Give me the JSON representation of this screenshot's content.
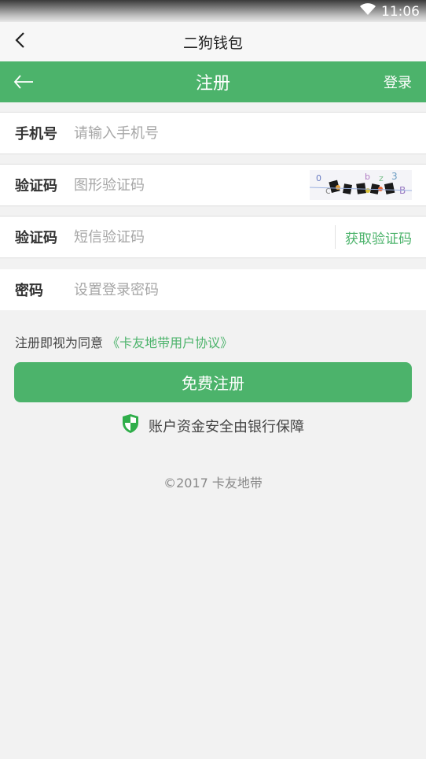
{
  "status_bar": {
    "time": "11:06",
    "wifi_icon": "wifi-icon"
  },
  "title_bar": {
    "title": "二狗钱包",
    "back_icon": "chevron-left-icon"
  },
  "header": {
    "title": "注册",
    "login_label": "登录",
    "back_icon": "arrow-left-icon"
  },
  "form": {
    "phone": {
      "label": "手机号",
      "placeholder": "请输入手机号",
      "value": ""
    },
    "captcha": {
      "label": "验证码",
      "placeholder": "图形验证码",
      "value": ""
    },
    "sms": {
      "label": "验证码",
      "placeholder": "短信验证码",
      "value": "",
      "button_label": "获取验证码"
    },
    "password": {
      "label": "密码",
      "placeholder": "设置登录密码",
      "value": ""
    }
  },
  "agreement": {
    "prefix": "注册即视为同意",
    "link_text": "《卡友地带用户协议》"
  },
  "submit_label": "免费注册",
  "security_note": {
    "text": "账户资金安全由银行保障",
    "icon": "shield-check-icon"
  },
  "copyright": "©2017 卡友地带",
  "colors": {
    "accent": "#4cb36b",
    "background": "#f2f2f2"
  }
}
